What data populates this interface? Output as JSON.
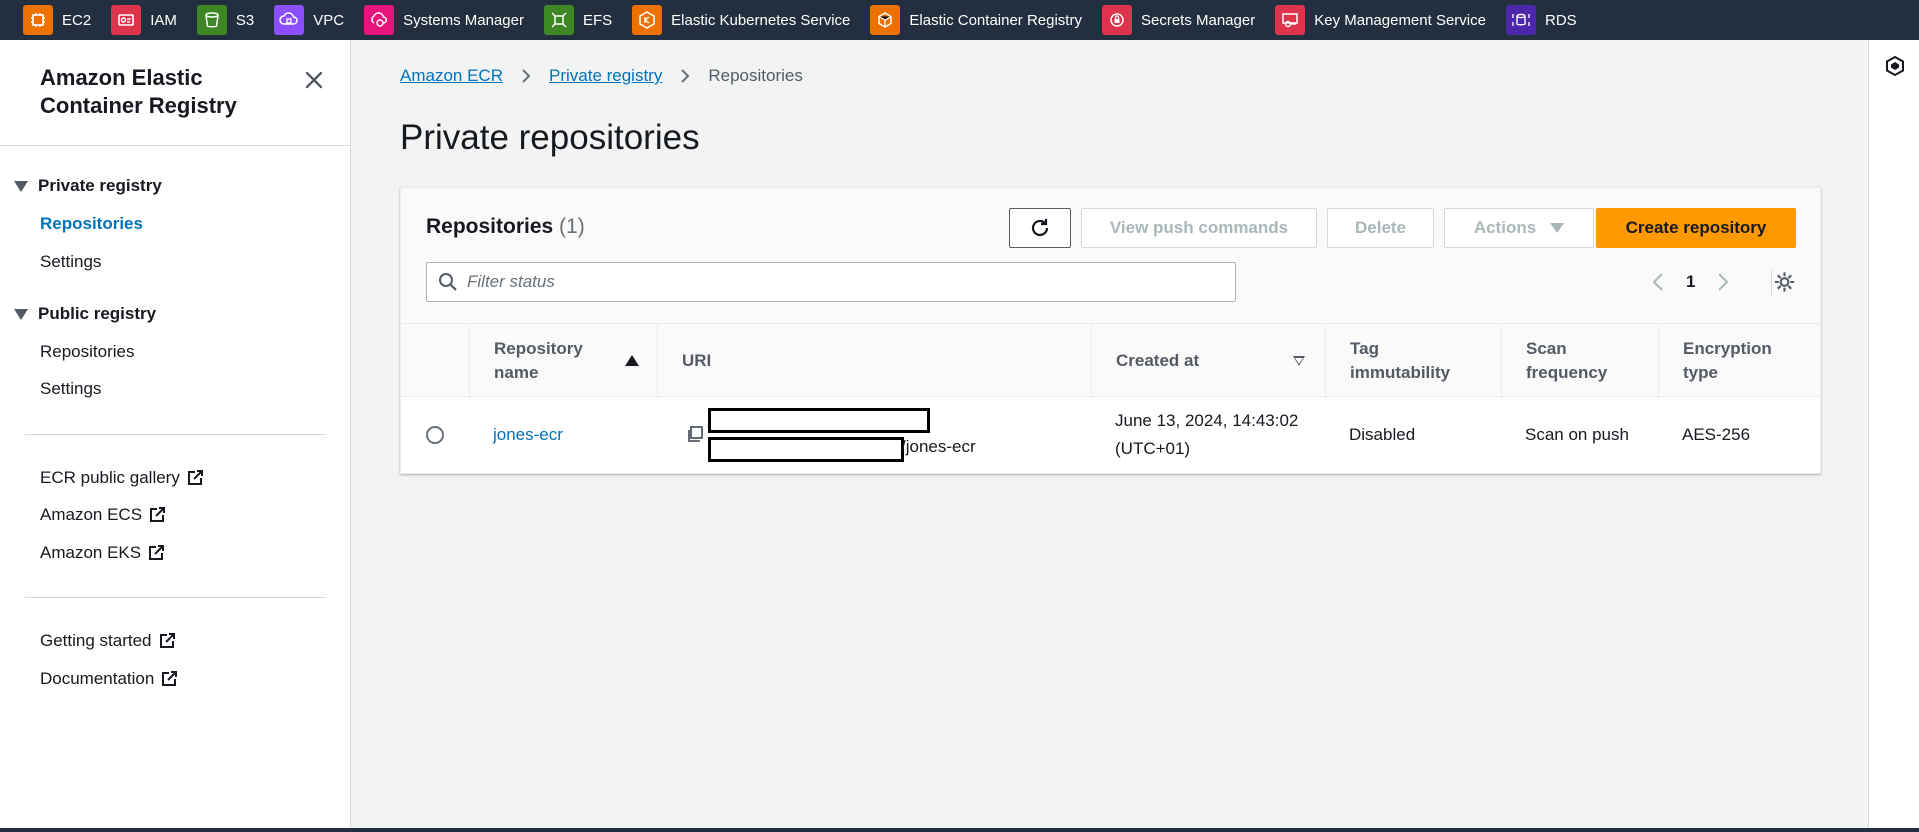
{
  "favorites": [
    {
      "label": "EC2",
      "icon": "ec2-icon",
      "color": "#ed7100"
    },
    {
      "label": "IAM",
      "icon": "iam-icon",
      "color": "#dd344c"
    },
    {
      "label": "S3",
      "icon": "s3-icon",
      "color": "#3f8624"
    },
    {
      "label": "VPC",
      "icon": "vpc-icon",
      "color": "#8c4fff"
    },
    {
      "label": "Systems Manager",
      "icon": "systems-manager-icon",
      "color": "#e7157b"
    },
    {
      "label": "EFS",
      "icon": "efs-icon",
      "color": "#3f8624"
    },
    {
      "label": "Elastic Kubernetes Service",
      "icon": "eks-icon",
      "color": "#ed7100"
    },
    {
      "label": "Elastic Container Registry",
      "icon": "ecr-icon",
      "color": "#ed7100"
    },
    {
      "label": "Secrets Manager",
      "icon": "secrets-manager-icon",
      "color": "#dd344c"
    },
    {
      "label": "Key Management Service",
      "icon": "kms-icon",
      "color": "#dd344c"
    },
    {
      "label": "RDS",
      "icon": "rds-icon",
      "color": "#4d27aa"
    }
  ],
  "sidenav": {
    "title": "Amazon Elastic Container Registry",
    "private_section": "Private registry",
    "private_items": [
      "Repositories",
      "Settings"
    ],
    "public_section": "Public registry",
    "public_items": [
      "Repositories",
      "Settings"
    ],
    "external_links": [
      "ECR public gallery",
      "Amazon ECS",
      "Amazon EKS"
    ],
    "help_links": [
      "Getting started",
      "Documentation"
    ]
  },
  "breadcrumb": {
    "items": [
      "Amazon ECR",
      "Private registry"
    ],
    "current": "Repositories"
  },
  "page_title": "Private repositories",
  "panel": {
    "title": "Repositories",
    "count": "(1)",
    "buttons": {
      "view_push": "View push commands",
      "delete": "Delete",
      "actions": "Actions",
      "create": "Create repository"
    },
    "filter_placeholder": "Filter status",
    "page_number": "1"
  },
  "table": {
    "columns": [
      "Repository name",
      "URI",
      "Created at",
      "Tag immutability",
      "Scan frequency",
      "Encryption type"
    ],
    "rows": [
      {
        "name": "jones-ecr",
        "uri_suffix": "/jones-ecr",
        "created": "June 13, 2024, 14:43:02 (UTC+01)",
        "tag_immutability": "Disabled",
        "scan_frequency": "Scan on push",
        "encryption": "AES-256"
      }
    ]
  },
  "colors": {
    "topbar": "#232f3e",
    "link": "#0073bb",
    "primary_button": "#ff9900"
  }
}
